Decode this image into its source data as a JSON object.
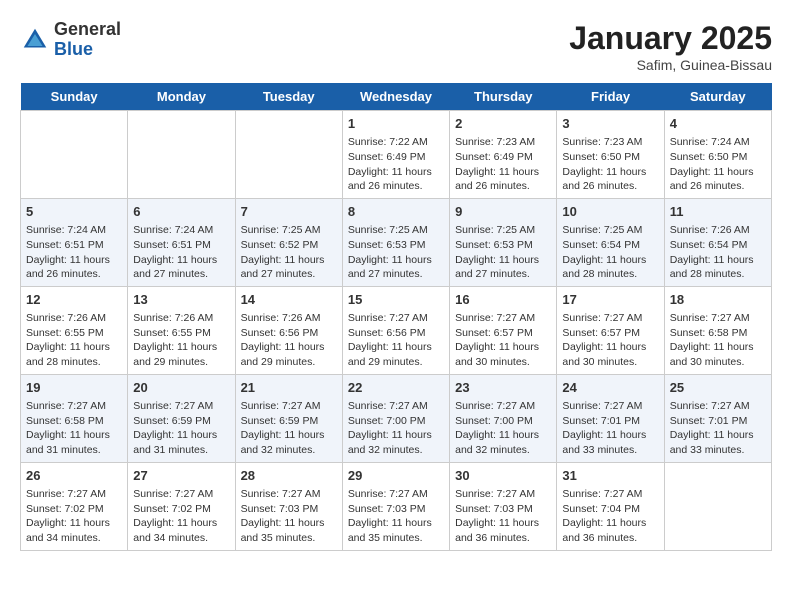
{
  "logo": {
    "general": "General",
    "blue": "Blue"
  },
  "header": {
    "month": "January 2025",
    "location": "Safim, Guinea-Bissau"
  },
  "weekdays": [
    "Sunday",
    "Monday",
    "Tuesday",
    "Wednesday",
    "Thursday",
    "Friday",
    "Saturday"
  ],
  "weeks": [
    [
      {
        "day": "",
        "info": ""
      },
      {
        "day": "",
        "info": ""
      },
      {
        "day": "",
        "info": ""
      },
      {
        "day": "1",
        "sunrise": "7:22 AM",
        "sunset": "6:49 PM",
        "daylight": "11 hours and 26 minutes."
      },
      {
        "day": "2",
        "sunrise": "7:23 AM",
        "sunset": "6:49 PM",
        "daylight": "11 hours and 26 minutes."
      },
      {
        "day": "3",
        "sunrise": "7:23 AM",
        "sunset": "6:50 PM",
        "daylight": "11 hours and 26 minutes."
      },
      {
        "day": "4",
        "sunrise": "7:24 AM",
        "sunset": "6:50 PM",
        "daylight": "11 hours and 26 minutes."
      }
    ],
    [
      {
        "day": "5",
        "sunrise": "7:24 AM",
        "sunset": "6:51 PM",
        "daylight": "11 hours and 26 minutes."
      },
      {
        "day": "6",
        "sunrise": "7:24 AM",
        "sunset": "6:51 PM",
        "daylight": "11 hours and 27 minutes."
      },
      {
        "day": "7",
        "sunrise": "7:25 AM",
        "sunset": "6:52 PM",
        "daylight": "11 hours and 27 minutes."
      },
      {
        "day": "8",
        "sunrise": "7:25 AM",
        "sunset": "6:53 PM",
        "daylight": "11 hours and 27 minutes."
      },
      {
        "day": "9",
        "sunrise": "7:25 AM",
        "sunset": "6:53 PM",
        "daylight": "11 hours and 27 minutes."
      },
      {
        "day": "10",
        "sunrise": "7:25 AM",
        "sunset": "6:54 PM",
        "daylight": "11 hours and 28 minutes."
      },
      {
        "day": "11",
        "sunrise": "7:26 AM",
        "sunset": "6:54 PM",
        "daylight": "11 hours and 28 minutes."
      }
    ],
    [
      {
        "day": "12",
        "sunrise": "7:26 AM",
        "sunset": "6:55 PM",
        "daylight": "11 hours and 28 minutes."
      },
      {
        "day": "13",
        "sunrise": "7:26 AM",
        "sunset": "6:55 PM",
        "daylight": "11 hours and 29 minutes."
      },
      {
        "day": "14",
        "sunrise": "7:26 AM",
        "sunset": "6:56 PM",
        "daylight": "11 hours and 29 minutes."
      },
      {
        "day": "15",
        "sunrise": "7:27 AM",
        "sunset": "6:56 PM",
        "daylight": "11 hours and 29 minutes."
      },
      {
        "day": "16",
        "sunrise": "7:27 AM",
        "sunset": "6:57 PM",
        "daylight": "11 hours and 30 minutes."
      },
      {
        "day": "17",
        "sunrise": "7:27 AM",
        "sunset": "6:57 PM",
        "daylight": "11 hours and 30 minutes."
      },
      {
        "day": "18",
        "sunrise": "7:27 AM",
        "sunset": "6:58 PM",
        "daylight": "11 hours and 30 minutes."
      }
    ],
    [
      {
        "day": "19",
        "sunrise": "7:27 AM",
        "sunset": "6:58 PM",
        "daylight": "11 hours and 31 minutes."
      },
      {
        "day": "20",
        "sunrise": "7:27 AM",
        "sunset": "6:59 PM",
        "daylight": "11 hours and 31 minutes."
      },
      {
        "day": "21",
        "sunrise": "7:27 AM",
        "sunset": "6:59 PM",
        "daylight": "11 hours and 32 minutes."
      },
      {
        "day": "22",
        "sunrise": "7:27 AM",
        "sunset": "7:00 PM",
        "daylight": "11 hours and 32 minutes."
      },
      {
        "day": "23",
        "sunrise": "7:27 AM",
        "sunset": "7:00 PM",
        "daylight": "11 hours and 32 minutes."
      },
      {
        "day": "24",
        "sunrise": "7:27 AM",
        "sunset": "7:01 PM",
        "daylight": "11 hours and 33 minutes."
      },
      {
        "day": "25",
        "sunrise": "7:27 AM",
        "sunset": "7:01 PM",
        "daylight": "11 hours and 33 minutes."
      }
    ],
    [
      {
        "day": "26",
        "sunrise": "7:27 AM",
        "sunset": "7:02 PM",
        "daylight": "11 hours and 34 minutes."
      },
      {
        "day": "27",
        "sunrise": "7:27 AM",
        "sunset": "7:02 PM",
        "daylight": "11 hours and 34 minutes."
      },
      {
        "day": "28",
        "sunrise": "7:27 AM",
        "sunset": "7:03 PM",
        "daylight": "11 hours and 35 minutes."
      },
      {
        "day": "29",
        "sunrise": "7:27 AM",
        "sunset": "7:03 PM",
        "daylight": "11 hours and 35 minutes."
      },
      {
        "day": "30",
        "sunrise": "7:27 AM",
        "sunset": "7:03 PM",
        "daylight": "11 hours and 36 minutes."
      },
      {
        "day": "31",
        "sunrise": "7:27 AM",
        "sunset": "7:04 PM",
        "daylight": "11 hours and 36 minutes."
      },
      {
        "day": "",
        "info": ""
      }
    ]
  ],
  "labels": {
    "sunrise": "Sunrise:",
    "sunset": "Sunset:",
    "daylight": "Daylight:"
  }
}
